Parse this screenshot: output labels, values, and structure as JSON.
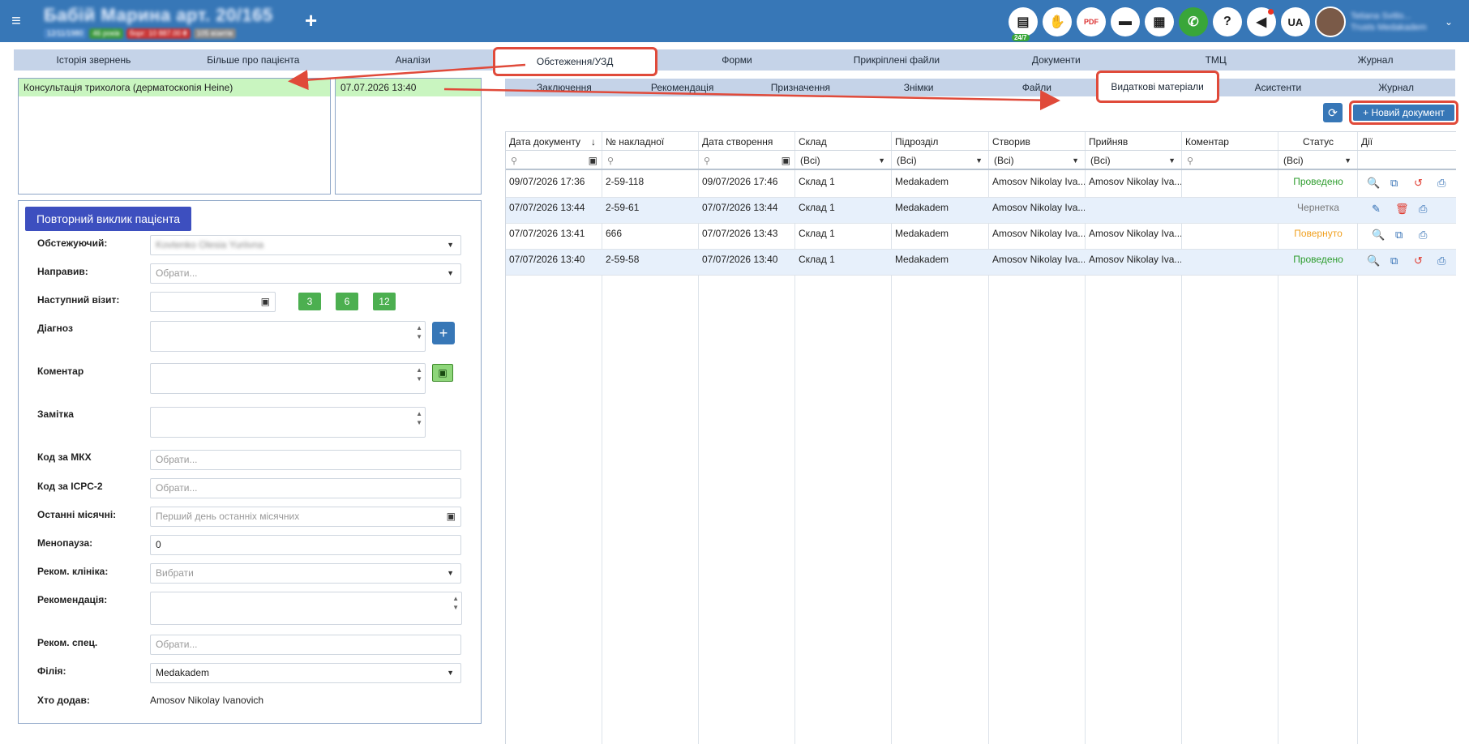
{
  "header": {
    "menu_icon": "hamburger-icon",
    "patient_name": "Бабій Марина арт. 20/165",
    "patient_chips": [
      "12/11/1980",
      "46 років",
      "борг: 10 887.00 ₴",
      "105 візитів"
    ],
    "add_icon": "plus-icon",
    "icons": [
      {
        "name": "chat-icon",
        "glyph": "💬",
        "badge": "24/7"
      },
      {
        "name": "hand-icon",
        "glyph": "✋"
      },
      {
        "name": "pdf-icon",
        "glyph": "PDF"
      },
      {
        "name": "card-icon",
        "glyph": "▬"
      },
      {
        "name": "calculator-icon",
        "glyph": "▦"
      },
      {
        "name": "phone-icon",
        "glyph": "✆"
      },
      {
        "name": "help-icon",
        "glyph": "?"
      },
      {
        "name": "megaphone-icon",
        "glyph": "📢"
      }
    ],
    "lang": "UA",
    "user_name": "Tetiana Svitlo...",
    "user_role": "Trusts Medakadem"
  },
  "main_tabs": [
    "Історія звернень",
    "Більше про пацієнта",
    "Аналізи",
    "Обстеження/УЗД",
    "Форми",
    "Прикріплені файли",
    "Документи",
    "ТМЦ",
    "Журнал"
  ],
  "left": {
    "visit_type": "Консультація трихолога (дерматоскопія Heine)",
    "visit_date": "07.07.2026 13:40",
    "recall_button": "Повторний виклик пацієнта",
    "fields": {
      "examiner_label": "Обстежуючий:",
      "examiner_value": "Kovtenko Olesia Yuriivna",
      "referred_label": "Направив:",
      "referred_placeholder": "Обрати...",
      "next_visit_label": "Наступний візит:",
      "next_visit_buttons": [
        "3",
        "6",
        "12"
      ],
      "diagnosis_label": "Діагноз",
      "comment_label": "Коментар",
      "note_label": "Замітка",
      "icd_label": "Код за МКХ",
      "icd_placeholder": "Обрати...",
      "icpc_label": "Код за ICPC-2",
      "icpc_placeholder": "Обрати...",
      "last_period_label": "Останні місячні:",
      "last_period_placeholder": "Перший день останніх місячних",
      "menopause_label": "Менопауза:",
      "menopause_value": "0",
      "rec_clinic_label": "Реком. клініка:",
      "rec_clinic_placeholder": "Вибрати",
      "recommendation_label": "Рекомендація:",
      "rec_spec_label": "Реком. спец.",
      "rec_spec_placeholder": "Обрати...",
      "branch_label": "Філія:",
      "branch_value": "Medakadem",
      "added_by_label": "Хто додав:",
      "added_by_value": "Amosov Nikolay Ivanovich"
    }
  },
  "sub_tabs": [
    "Заключення",
    "Рекомендація",
    "Призначення",
    "Знімки",
    "Файли",
    "Видаткові матеріали",
    "Асистенти",
    "Журнал"
  ],
  "toolbar": {
    "refresh_icon": "refresh-icon",
    "new_document": "Новий документ"
  },
  "grid": {
    "columns": [
      "Дата документу",
      "№ накладної",
      "Дата створення",
      "Склад",
      "Підрозділ",
      "Створив",
      "Прийняв",
      "Коментар",
      "Статус",
      "Дії"
    ],
    "filters": {
      "all": "(Всі)"
    },
    "rows": [
      {
        "doc_date": "09/07/2026 17:36",
        "invoice": "2-59-118",
        "created": "09/07/2026 17:46",
        "warehouse": "Склад 1",
        "division": "Medakadem",
        "creator": "Amosov Nikolay Iva...",
        "acceptor": "Amosov Nikolay Iva...",
        "comment": "",
        "status": "Проведено",
        "status_color": "#2e9d2e",
        "actions": [
          "search-icon",
          "copy-icon",
          "undo-icon",
          "print-icon"
        ]
      },
      {
        "doc_date": "07/07/2026 13:44",
        "invoice": "2-59-61",
        "created": "07/07/2026 13:44",
        "warehouse": "Склад 1",
        "division": "Medakadem",
        "creator": "Amosov Nikolay Iva...",
        "acceptor": "",
        "comment": "",
        "status": "Чернетка",
        "status_color": "#777777",
        "actions": [
          "edit-icon",
          "delete-icon",
          "print-icon"
        ]
      },
      {
        "doc_date": "07/07/2026 13:41",
        "invoice": "666",
        "created": "07/07/2026 13:43",
        "warehouse": "Склад 1",
        "division": "Medakadem",
        "creator": "Amosov Nikolay Iva...",
        "acceptor": "Amosov Nikolay Iva...",
        "comment": "",
        "status": "Повернуто",
        "status_color": "#f0a020",
        "actions": [
          "search-icon",
          "copy-icon",
          "print-icon"
        ]
      },
      {
        "doc_date": "07/07/2026 13:40",
        "invoice": "2-59-58",
        "created": "07/07/2026 13:40",
        "warehouse": "Склад 1",
        "division": "Medakadem",
        "creator": "Amosov Nikolay Iva...",
        "acceptor": "Amosov Nikolay Iva...",
        "comment": "",
        "status": "Проведено",
        "status_color": "#2e9d2e",
        "actions": [
          "search-icon",
          "copy-icon",
          "undo-icon",
          "print-icon"
        ]
      }
    ]
  },
  "colors": {
    "topbar": "#3777b7",
    "tabs_bg": "#c5d3e8",
    "highlight": "#e04a3a",
    "selected_row": "#c9f5c0"
  }
}
